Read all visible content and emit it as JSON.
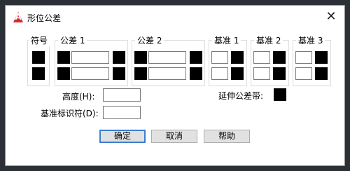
{
  "window": {
    "title": "形位公差",
    "icon": "autocad-a-icon",
    "close_glyph": "✕"
  },
  "groups": {
    "symbol": "符号",
    "tol1": "公差 1",
    "tol2": "公差 2",
    "datum1": "基准 1",
    "datum2": "基准 2",
    "datum3": "基准 3"
  },
  "fields": {
    "height_label": "高度(H):",
    "height_value": "",
    "datum_id_label": "基准标识符(D):",
    "datum_id_value": "",
    "projected_zone_label": "延伸公差带:"
  },
  "buttons": {
    "ok": "确定",
    "cancel": "取消",
    "help": "帮助"
  }
}
